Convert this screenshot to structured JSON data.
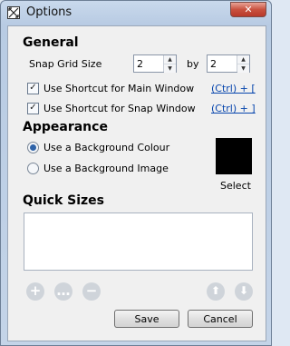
{
  "window": {
    "title": "Options",
    "close_glyph": "✕"
  },
  "general": {
    "heading": "General",
    "snap_grid_label": "Snap Grid Size",
    "snap_x": "2",
    "by_label": "by",
    "snap_y": "2",
    "shortcut_main": {
      "label": "Use Shortcut for Main Window",
      "checked": true,
      "key": "(Ctrl) + ["
    },
    "shortcut_snap": {
      "label": "Use Shortcut for Snap Window",
      "checked": true,
      "key": "(Ctrl) + ]"
    }
  },
  "appearance": {
    "heading": "Appearance",
    "option_colour": "Use a Background Colour",
    "option_image": "Use a Background Image",
    "selected": "colour",
    "swatch_color": "#000000",
    "select_label": "Select"
  },
  "quick_sizes": {
    "heading": "Quick Sizes",
    "items": [],
    "add_glyph": "+",
    "edit_glyph": "…",
    "remove_glyph": "−",
    "up_glyph": "⬆",
    "down_glyph": "⬇"
  },
  "footer": {
    "save_label": "Save",
    "cancel_label": "Cancel"
  }
}
